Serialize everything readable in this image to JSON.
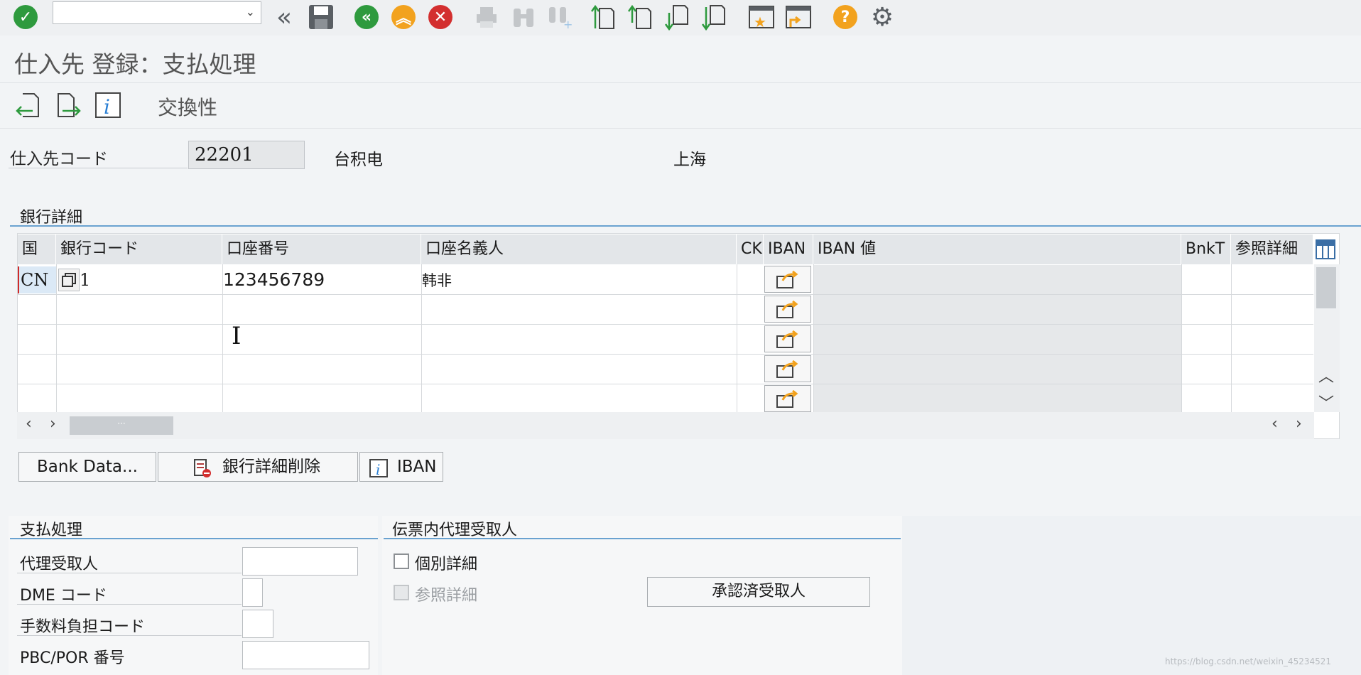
{
  "toolbar": {
    "command_value": "",
    "icons": [
      "check-icon",
      "back-double-icon",
      "save-icon",
      "back-icon",
      "exit-icon",
      "cancel-icon",
      "print-icon",
      "find-icon",
      "find-next-icon",
      "first-page-icon",
      "previous-page-icon",
      "next-page-icon",
      "last-page-icon",
      "new-session-icon",
      "shortcut-icon",
      "help-icon",
      "settings-icon"
    ],
    "colors": {
      "green": "#2e9a3e",
      "orange": "#f2a21e",
      "red": "#d32f2f",
      "gray": "#5a5f64"
    }
  },
  "title": "仕入先 登録：支払処理",
  "app_toolbar": {
    "exchange_label": "交換性"
  },
  "vendor": {
    "label": "仕入先コード",
    "code": "22201",
    "name": "台积电",
    "city": "上海"
  },
  "bank": {
    "section_title": "銀行詳細",
    "columns": [
      "国",
      "銀行コード",
      "口座番号",
      "口座名義人",
      "CK",
      "IBAN",
      "IBAN 値",
      "BnkT",
      "参照詳細"
    ],
    "rows": [
      {
        "country": "CN",
        "bank_code": "1",
        "account": "123456789",
        "holder": "韩非"
      }
    ],
    "buttons": {
      "bank_data": "Bank Data...",
      "delete": "銀行詳細削除",
      "iban": "IBAN"
    }
  },
  "payment": {
    "section_title": "支払処理",
    "fields": [
      "代理受取人",
      "DME コード",
      "手数料負担コード",
      "PBC/POR 番号"
    ]
  },
  "alt_payee": {
    "section_title": "伝票内代理受取人",
    "individual": "個別詳細",
    "reference": "参照詳細",
    "approved_button": "承認済受取人"
  },
  "watermark": "https://blog.csdn.net/weixin_45234521"
}
